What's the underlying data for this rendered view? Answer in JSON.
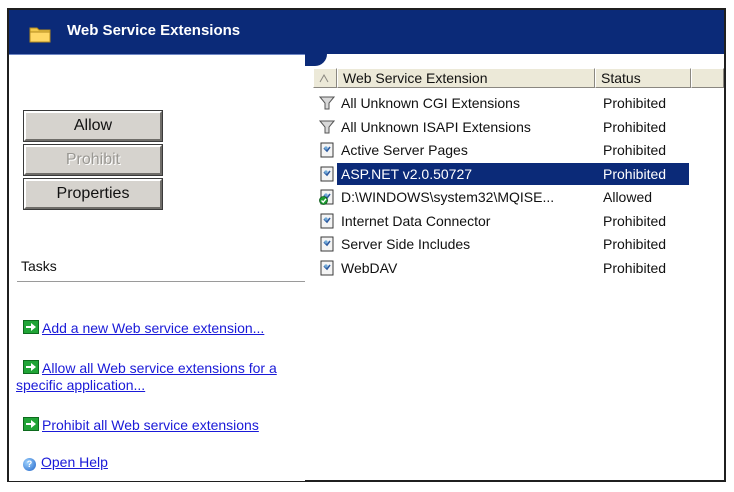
{
  "window": {
    "title": "Web Service Extensions"
  },
  "buttons": {
    "allow": "Allow",
    "prohibit": "Prohibit",
    "properties": "Properties"
  },
  "tasks": {
    "heading": "Tasks",
    "items": [
      {
        "line1": "Add a new Web service extension...",
        "line2": ""
      },
      {
        "line1": "Allow all Web service extensions for a",
        "line2": "specific application..."
      },
      {
        "line1": "Prohibit all Web service extensions",
        "line2": ""
      }
    ],
    "help": "Open Help"
  },
  "list": {
    "columns": [
      "Web Service Extension",
      "Status"
    ],
    "rows": [
      {
        "name": "All Unknown CGI Extensions",
        "status": "Prohibited",
        "icon": "filter-icon",
        "selected": false
      },
      {
        "name": "All Unknown ISAPI Extensions",
        "status": "Prohibited",
        "icon": "filter-icon",
        "selected": false
      },
      {
        "name": "Active Server Pages",
        "status": "Prohibited",
        "icon": "extension-icon",
        "selected": false
      },
      {
        "name": "ASP.NET v2.0.50727",
        "status": "Prohibited",
        "icon": "extension-icon",
        "selected": true
      },
      {
        "name": "D:\\WINDOWS\\system32\\MQISE...",
        "status": "Allowed",
        "icon": "allowed-extension-icon",
        "selected": false
      },
      {
        "name": "Internet Data Connector",
        "status": "Prohibited",
        "icon": "extension-icon",
        "selected": false
      },
      {
        "name": "Server Side Includes",
        "status": "Prohibited",
        "icon": "extension-icon",
        "selected": false
      },
      {
        "name": "WebDAV",
        "status": "Prohibited",
        "icon": "extension-icon",
        "selected": false
      }
    ]
  },
  "colors": {
    "titlebar": "#0b2a78",
    "selection": "#0b2a78",
    "link": "#1a1ad8"
  }
}
